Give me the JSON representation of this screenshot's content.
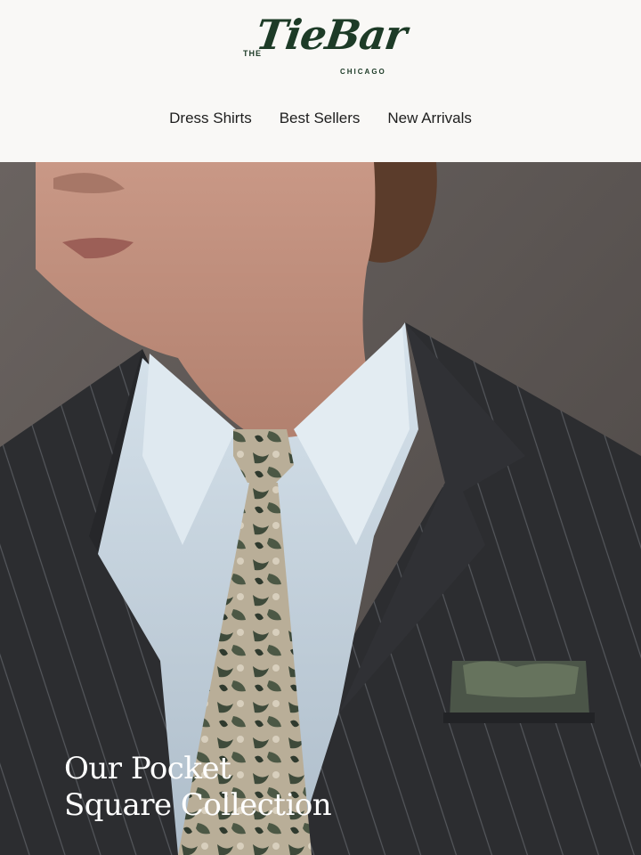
{
  "brand": {
    "prefix": "THE",
    "name": "TieBar",
    "city": "CHICAGO",
    "color": "#1d3b27"
  },
  "nav": {
    "items": [
      {
        "label": "Dress Shirts"
      },
      {
        "label": "Best Sellers"
      },
      {
        "label": "New Arrivals"
      }
    ]
  },
  "hero": {
    "title_line1": "Our Pocket",
    "title_line2": "Square Collection"
  }
}
